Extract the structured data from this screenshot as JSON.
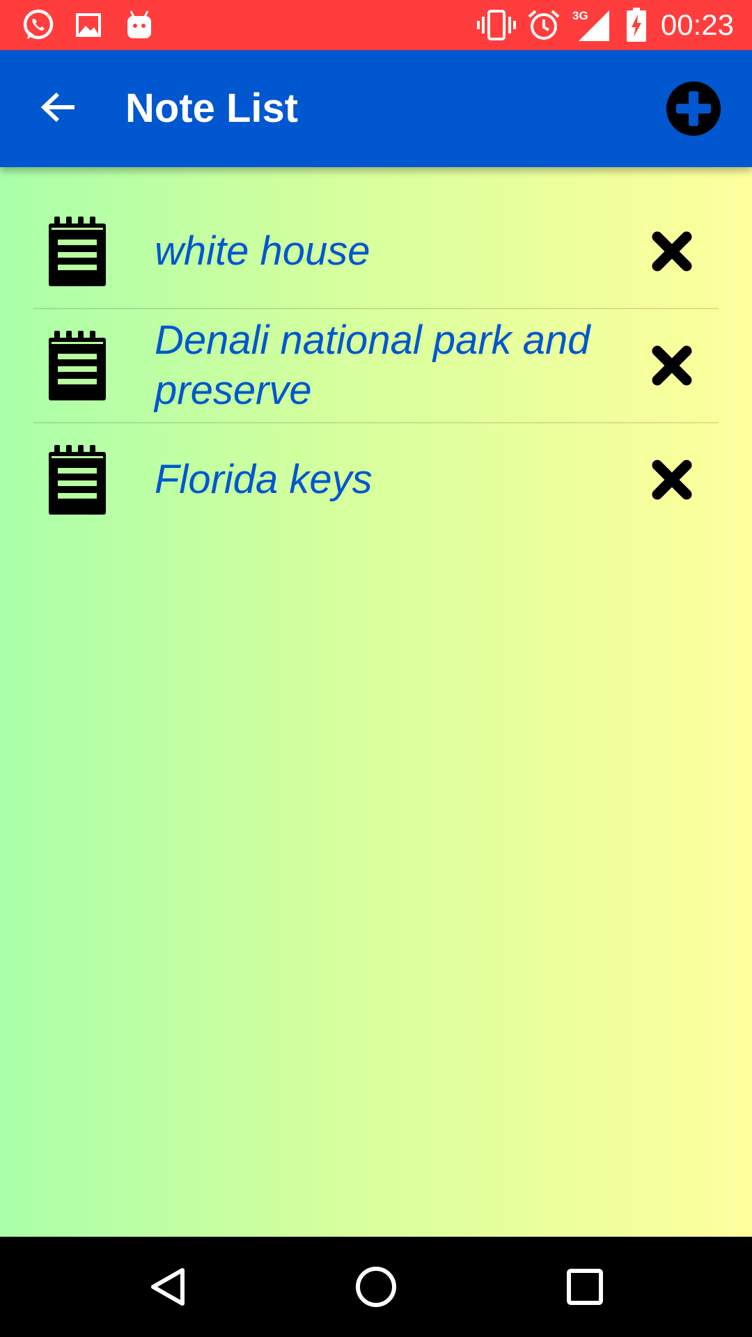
{
  "status_bar": {
    "time": "00:23",
    "network": "3G",
    "icons": [
      "whatsapp-icon",
      "image-icon",
      "android-debug-icon",
      "vibrate-icon",
      "alarm-icon",
      "signal-icon",
      "battery-charging-icon"
    ],
    "background_color": "#ff3d3d"
  },
  "app_bar": {
    "title": "Note List",
    "back_icon": "arrow-back-icon",
    "add_icon": "add-circle-icon",
    "background_color": "#0057cf"
  },
  "notes": [
    {
      "title": "white house",
      "icon": "notepad-icon",
      "delete_icon": "close-icon"
    },
    {
      "title": "Denali national park and preserve",
      "icon": "notepad-icon",
      "delete_icon": "close-icon"
    },
    {
      "title": "Florida keys",
      "icon": "notepad-icon",
      "delete_icon": "close-icon"
    }
  ],
  "theme": {
    "note_text_color": "#0057cf",
    "gradient_start": "#a9ffa9",
    "gradient_end": "#ffff9d"
  },
  "nav_bar": {
    "icons": [
      "back-triangle-icon",
      "home-circle-icon",
      "recents-square-icon"
    ]
  }
}
